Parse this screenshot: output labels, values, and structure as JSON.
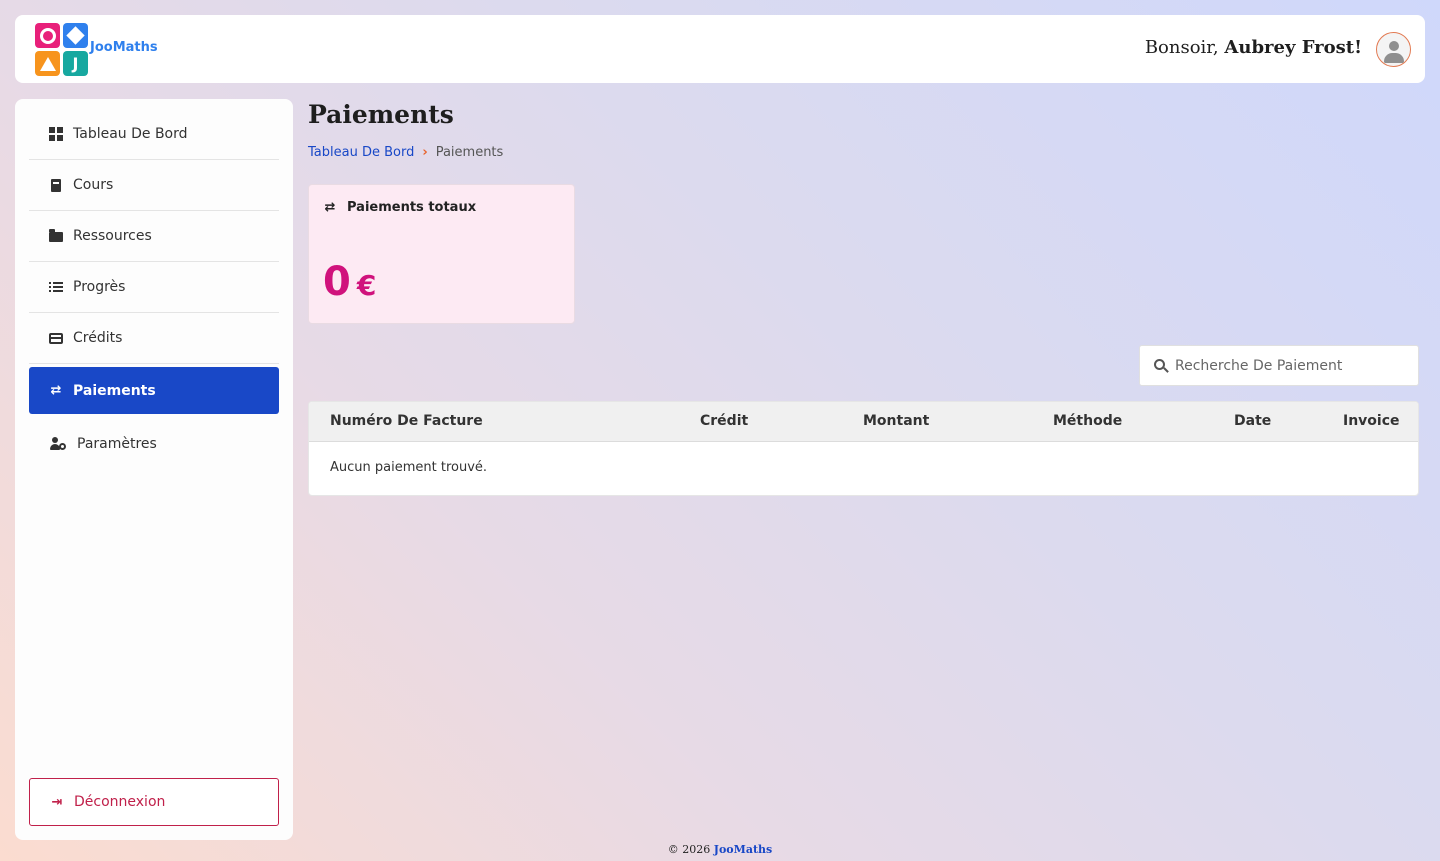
{
  "brand": {
    "name": "JooMaths",
    "logo_letter": "J"
  },
  "header": {
    "greeting_prefix": "Bonsoir,",
    "user_name": "Aubrey Frost!"
  },
  "sidebar": {
    "items": [
      {
        "label": "Tableau De Bord",
        "icon": "dashboard-grid-icon"
      },
      {
        "label": "Cours",
        "icon": "book-icon"
      },
      {
        "label": "Ressources",
        "icon": "folder-icon"
      },
      {
        "label": "Progrès",
        "icon": "list-check-icon"
      },
      {
        "label": "Crédits",
        "icon": "credit-card-icon"
      },
      {
        "label": "Paiements",
        "icon": "exchange-arrows-icon",
        "active": true
      },
      {
        "label": "Paramètres",
        "icon": "user-gear-icon"
      }
    ],
    "logout_label": "Déconnexion"
  },
  "page": {
    "title": "Paiements",
    "breadcrumb": {
      "home": "Tableau De Bord",
      "current": "Paiements"
    }
  },
  "stat_card": {
    "title": "Paiements totaux",
    "value": "0",
    "unit": "€"
  },
  "search": {
    "placeholder": "Recherche De Paiement"
  },
  "table": {
    "columns": [
      "Numéro De Facture",
      "Crédit",
      "Montant",
      "Méthode",
      "Date",
      "Invoice"
    ],
    "empty_message": "Aucun paiement trouvé."
  },
  "footer": {
    "copyright": "© 2026",
    "brand": "JooMaths"
  },
  "colors": {
    "primary": "#1948c7",
    "accent_pink": "#d0127c",
    "danger": "#c0204a",
    "breadcrumb_chevron": "#e8622a"
  }
}
